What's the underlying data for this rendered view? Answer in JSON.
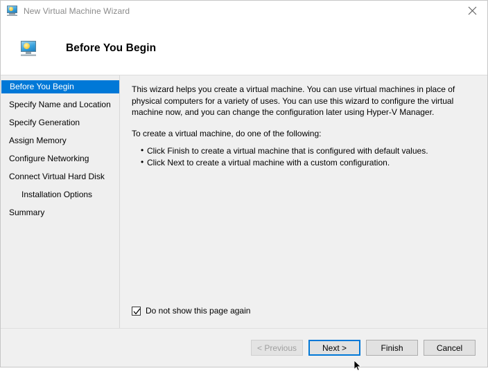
{
  "window": {
    "title": "New Virtual Machine Wizard",
    "title_icon": "virtual-machine-monitor-icon",
    "close_icon": "close-icon",
    "accent_color": "#0078d7",
    "titlebar_bg": "#ffffff",
    "dialog_bg": "#f0f0f0"
  },
  "header": {
    "icon": "virtual-machine-monitor-icon",
    "title": "Before You Begin"
  },
  "sidebar": {
    "items": [
      {
        "label": "Before You Begin",
        "selected": true,
        "indented": false
      },
      {
        "label": "Specify Name and Location",
        "selected": false,
        "indented": false
      },
      {
        "label": "Specify Generation",
        "selected": false,
        "indented": false
      },
      {
        "label": "Assign Memory",
        "selected": false,
        "indented": false
      },
      {
        "label": "Configure Networking",
        "selected": false,
        "indented": false
      },
      {
        "label": "Connect Virtual Hard Disk",
        "selected": false,
        "indented": false
      },
      {
        "label": "Installation Options",
        "selected": false,
        "indented": true
      },
      {
        "label": "Summary",
        "selected": false,
        "indented": false
      }
    ]
  },
  "content": {
    "paragraph1": "This wizard helps you create a virtual machine. You can use virtual machines in place of physical computers for a variety of uses. You can use this wizard to configure the virtual machine now, and you can change the configuration later using Hyper-V Manager.",
    "paragraph2": "To create a virtual machine, do one of the following:",
    "bullets": [
      "Click Finish to create a virtual machine that is configured with default values.",
      "Click Next to create a virtual machine with a custom configuration."
    ],
    "checkbox": {
      "label": "Do not show this page again",
      "checked": true
    }
  },
  "footer": {
    "buttons": [
      {
        "label": "< Previous",
        "state": "disabled"
      },
      {
        "label": "Next >",
        "state": "focused"
      },
      {
        "label": "Finish",
        "state": "normal"
      },
      {
        "label": "Cancel",
        "state": "normal"
      }
    ]
  }
}
